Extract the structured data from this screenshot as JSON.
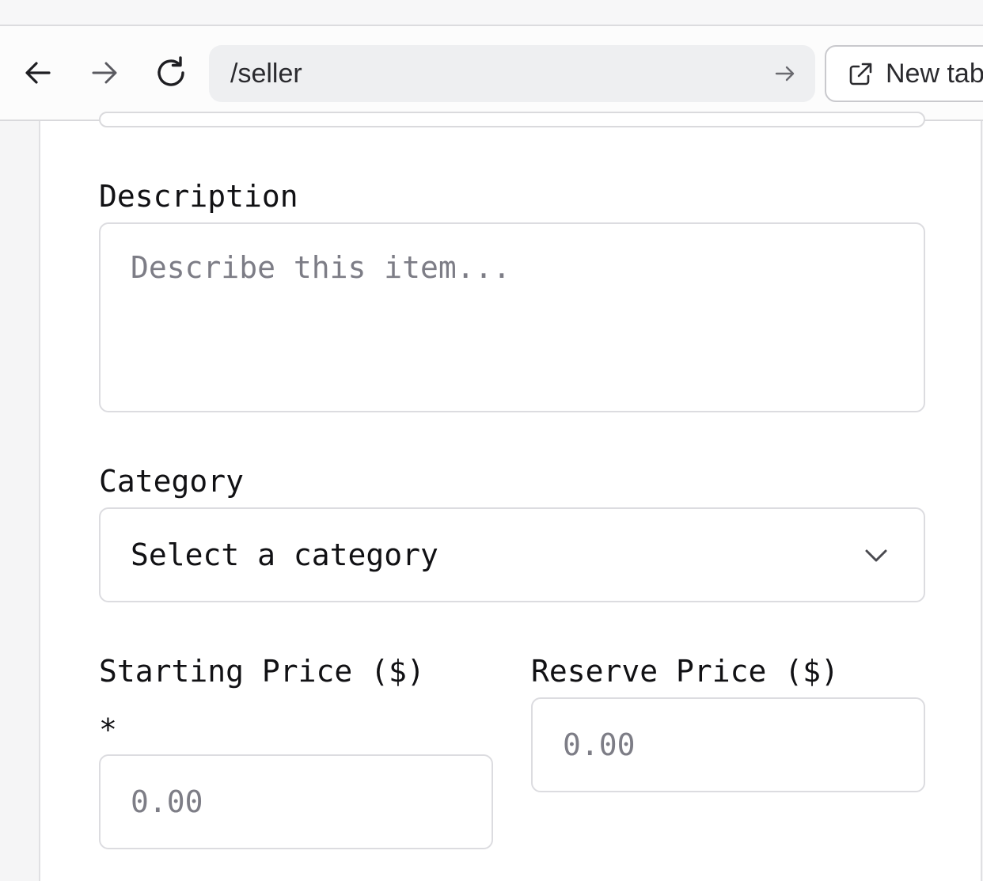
{
  "browser": {
    "url": "/seller",
    "new_tab_label": "New tab",
    "icons": {
      "back": "arrow-left-icon",
      "forward": "arrow-right-icon",
      "reload": "reload-icon",
      "go": "arrow-right-icon",
      "new_tab": "external-link-icon"
    }
  },
  "form": {
    "description": {
      "label": "Description",
      "placeholder": "Describe this item..."
    },
    "category": {
      "label": "Category",
      "selected": "Select a category"
    },
    "starting_price": {
      "label": "Starting Price ($)",
      "required_marker": "*",
      "placeholder": "0.00"
    },
    "reserve_price": {
      "label": "Reserve Price ($)",
      "placeholder": "0.00"
    }
  }
}
